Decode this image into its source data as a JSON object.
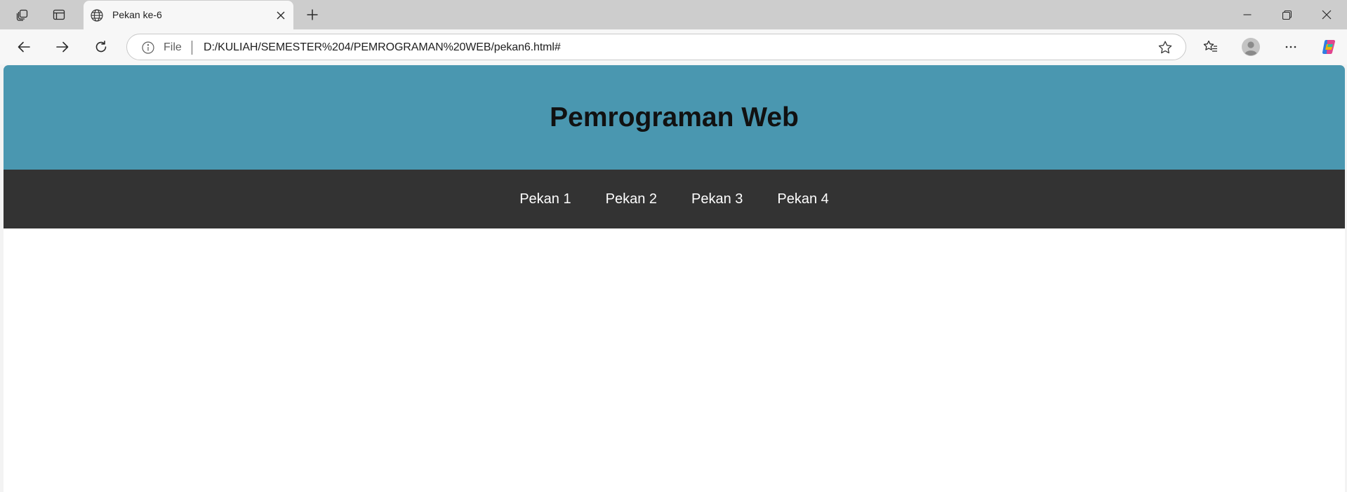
{
  "browser": {
    "tab": {
      "title": "Pekan ke-6",
      "favicon": "globe-icon"
    },
    "icons": {
      "workspaces": "workspaces-icon",
      "tab_actions": "tab-actions-icon",
      "new_tab": "plus-icon",
      "minimize": "minimize-icon",
      "restore": "restore-icon",
      "close": "close-icon",
      "back": "back-arrow-icon",
      "forward": "forward-arrow-icon",
      "refresh": "refresh-icon",
      "site_info": "info-icon",
      "favorite": "star-icon",
      "favorites_list": "favorites-icon",
      "profile": "avatar",
      "more": "more-icon",
      "copilot": "copilot-icon"
    },
    "address": {
      "scheme_label": "File",
      "url": "D:/KULIAH/SEMESTER%204/PEMROGRAMAN%20WEB/pekan6.html#"
    }
  },
  "page": {
    "header": {
      "title": "Pemrograman Web"
    },
    "nav": {
      "items": [
        {
          "label": "Pekan 1"
        },
        {
          "label": "Pekan 2"
        },
        {
          "label": "Pekan 3"
        },
        {
          "label": "Pekan 4"
        }
      ]
    }
  },
  "colors": {
    "header_bg": "#4a97b0",
    "nav_bg": "#333333",
    "nav_text": "#ffffff",
    "title_text": "#111111"
  }
}
